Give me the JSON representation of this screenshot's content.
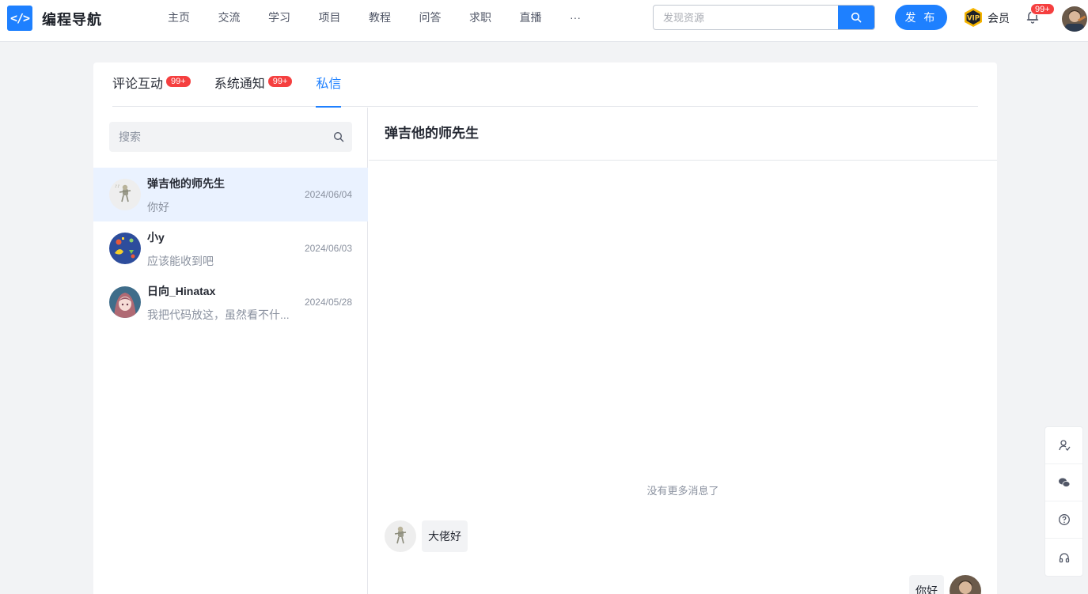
{
  "header": {
    "logo_glyph": "</>",
    "brand": "编程导航",
    "nav": [
      "主页",
      "交流",
      "学习",
      "项目",
      "教程",
      "问答",
      "求职",
      "直播",
      "···"
    ],
    "search_placeholder": "发现资源",
    "publish": "发 布",
    "vip_label": "会员",
    "notification_badge": "99+",
    "accent_color": "#1e80ff"
  },
  "tabs": [
    {
      "label": "评论互动",
      "badge": "99+"
    },
    {
      "label": "系统通知",
      "badge": "99+"
    },
    {
      "label": "私信",
      "badge": ""
    }
  ],
  "inbox": {
    "search_placeholder": "搜索",
    "conversations": [
      {
        "name": "弹吉他的师先生",
        "preview": "你好",
        "date": "2024/06/04",
        "active": true
      },
      {
        "name": "小y",
        "preview": "应该能收到吧",
        "date": "2024/06/03",
        "active": false
      },
      {
        "name": "日向_Hinatax",
        "preview": "我把代码放这，虽然看不什...",
        "date": "2024/05/28",
        "active": false
      }
    ]
  },
  "chat": {
    "title": "弹吉他的师先生",
    "no_more": "没有更多消息了",
    "messages": [
      {
        "from": "other",
        "text": "大佬好"
      },
      {
        "from": "me",
        "text": "你好"
      }
    ]
  },
  "side_toolbar": [
    "user-check-icon",
    "wechat-icon",
    "help-icon",
    "headset-icon"
  ]
}
